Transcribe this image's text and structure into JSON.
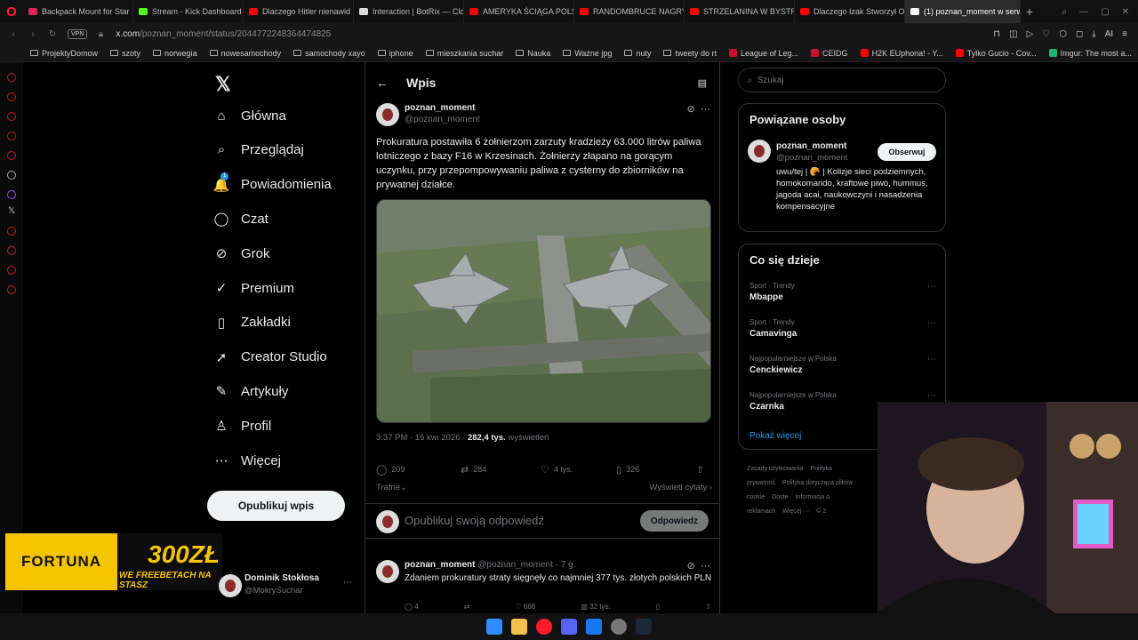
{
  "browser": {
    "tabs": [
      {
        "label": "Backpack Mount for Star",
        "color": "#e0245e"
      },
      {
        "label": "Stream - Kick Dashboard",
        "color": "#53fc18"
      },
      {
        "label": "Dlaczego Hitler nienawid",
        "color": "#ff0000"
      },
      {
        "label": "Interaction | BotRix — Clo",
        "color": "#dddddd"
      },
      {
        "label": "AMERYKA ŚCIĄGA POLSK",
        "color": "#ff0000"
      },
      {
        "label": "RANDOMBRUCE NAGRY",
        "color": "#ff0000"
      },
      {
        "label": "STRZELANINA W BYSTR",
        "color": "#ff0000"
      },
      {
        "label": "Dlaczego Izak Stworzył O",
        "color": "#ff0000"
      },
      {
        "label": "(1) poznan_moment w serw",
        "color": "#ffffff",
        "active": true
      }
    ],
    "url_host": "x.com",
    "url_path": "/poznan_moment/status/2044772248364474825",
    "vpn_label": "VPN",
    "ai_label": "AI",
    "bookmarks": [
      {
        "label": "ProjektyDomow",
        "type": "folder"
      },
      {
        "label": "szoty",
        "type": "folder"
      },
      {
        "label": "norwegia",
        "type": "folder"
      },
      {
        "label": "nowesamochody",
        "type": "folder"
      },
      {
        "label": "samochody xayo",
        "type": "folder"
      },
      {
        "label": "iphone",
        "type": "folder"
      },
      {
        "label": "mieszkania suchar",
        "type": "folder"
      },
      {
        "label": "Nauka",
        "type": "folder"
      },
      {
        "label": "Ważne jpg",
        "type": "folder"
      },
      {
        "label": "nuty",
        "type": "folder"
      },
      {
        "label": "tweety do rt",
        "type": "folder"
      },
      {
        "label": "League of Leg...",
        "type": "site",
        "color": "#c8102e"
      },
      {
        "label": "CEIDG",
        "type": "site",
        "color": "#c8102e"
      },
      {
        "label": "H2K EUphoria! - Y...",
        "type": "site",
        "color": "#ff0000"
      },
      {
        "label": "Tylko Gucio - Cov...",
        "type": "site",
        "color": "#ff0000"
      },
      {
        "label": "Imgur: The most a...",
        "type": "site",
        "color": "#1bb76e"
      }
    ]
  },
  "nav": {
    "items": [
      {
        "label": "Główna",
        "icon": "home-icon",
        "glyph": "⌂"
      },
      {
        "label": "Przeglądaj",
        "icon": "search-icon",
        "glyph": "⌕"
      },
      {
        "label": "Powiadomienia",
        "icon": "bell-icon",
        "glyph": "🔔",
        "badge": "1"
      },
      {
        "label": "Czat",
        "icon": "chat-icon",
        "glyph": "◯"
      },
      {
        "label": "Grok",
        "icon": "grok-icon",
        "glyph": "⊘"
      },
      {
        "label": "Premium",
        "icon": "premium-icon",
        "glyph": "✓"
      },
      {
        "label": "Zakładki",
        "icon": "bookmark-icon",
        "glyph": "▯"
      },
      {
        "label": "Creator Studio",
        "icon": "rocket-icon",
        "glyph": "➚"
      },
      {
        "label": "Artykuły",
        "icon": "article-icon",
        "glyph": "✎"
      },
      {
        "label": "Profil",
        "icon": "profile-icon",
        "glyph": "♙"
      },
      {
        "label": "Więcej",
        "icon": "more-icon",
        "glyph": "⋯"
      }
    ],
    "post_button": "Opublikuj wpis",
    "profile": {
      "name": "Dominik Stokłosa",
      "handle": "@MokrySuchar"
    }
  },
  "main": {
    "header_title": "Wpis",
    "tweet": {
      "name": "poznan_moment",
      "handle": "@poznan_moment",
      "text": "Prokuratura postawiła 6 żołnierzom zarzuty kradzieży 63.000 litrów paliwa lotniczego z bazy F16 w Krzesinach. Żołnierzy złapano na gorącym uczynku, przy przepompowywaniu paliwa z cysterny do zbiorników na prywatnej działce.",
      "time": "3:37 PM · 16 kwi 2026 ·",
      "views_count": "282,4 tys.",
      "views_label": "wyświetleń",
      "replies": "209",
      "reposts": "284",
      "likes": "4 tys.",
      "bookmarks": "326",
      "sort_label": "Trafne",
      "quotes_label": "Wyświetl cytaty"
    },
    "reply_placeholder": "Opublikuj swoją odpowiedź",
    "reply_button": "Odpowiedz",
    "reply2": {
      "name": "poznan_moment",
      "handle": "@poznan_moment",
      "time": "· 7 g.",
      "text": "Zdaniem prokuratury straty sięgnęły co najmniej 377 tys. złotych polskich PLN",
      "replies": "4",
      "likes": "668",
      "views": "32 tys."
    }
  },
  "right": {
    "search_placeholder": "Szukaj",
    "related_title": "Powiązane osoby",
    "related": {
      "name": "poznan_moment",
      "handle": "@poznan_moment",
      "follow": "Obserwuj",
      "bio": "uwu/tej | 🥐 | Kolizje sieci podziemnych, homokomando, kraftowe piwo, hummus, jagoda acai, naukowczyni i nasadzenia kompensacyjne"
    },
    "trending_title": "Co się dzieje",
    "trends": [
      {
        "category": "Sport · Trendy",
        "name": "Mbappe"
      },
      {
        "category": "Sport · Trendy",
        "name": "Camavinga"
      },
      {
        "category": "Najpopularniejsze w Polska",
        "name": "Cenckiewicz"
      },
      {
        "category": "Najpopularniejsze w Polska",
        "name": "Czarnka"
      }
    ],
    "show_more": "Pokaż więcej",
    "footer": [
      "Zasady użytkowania",
      "Polityka prywatnoś",
      "Polityka dotycząca plików cookie",
      "Doste",
      "Informacja o reklamach",
      "Więcej ···",
      "© 2"
    ]
  },
  "ad": {
    "brand": "FORTUNA",
    "amount": "300ZŁ",
    "tagline": "WE FREEBETACH NA STASZ"
  }
}
